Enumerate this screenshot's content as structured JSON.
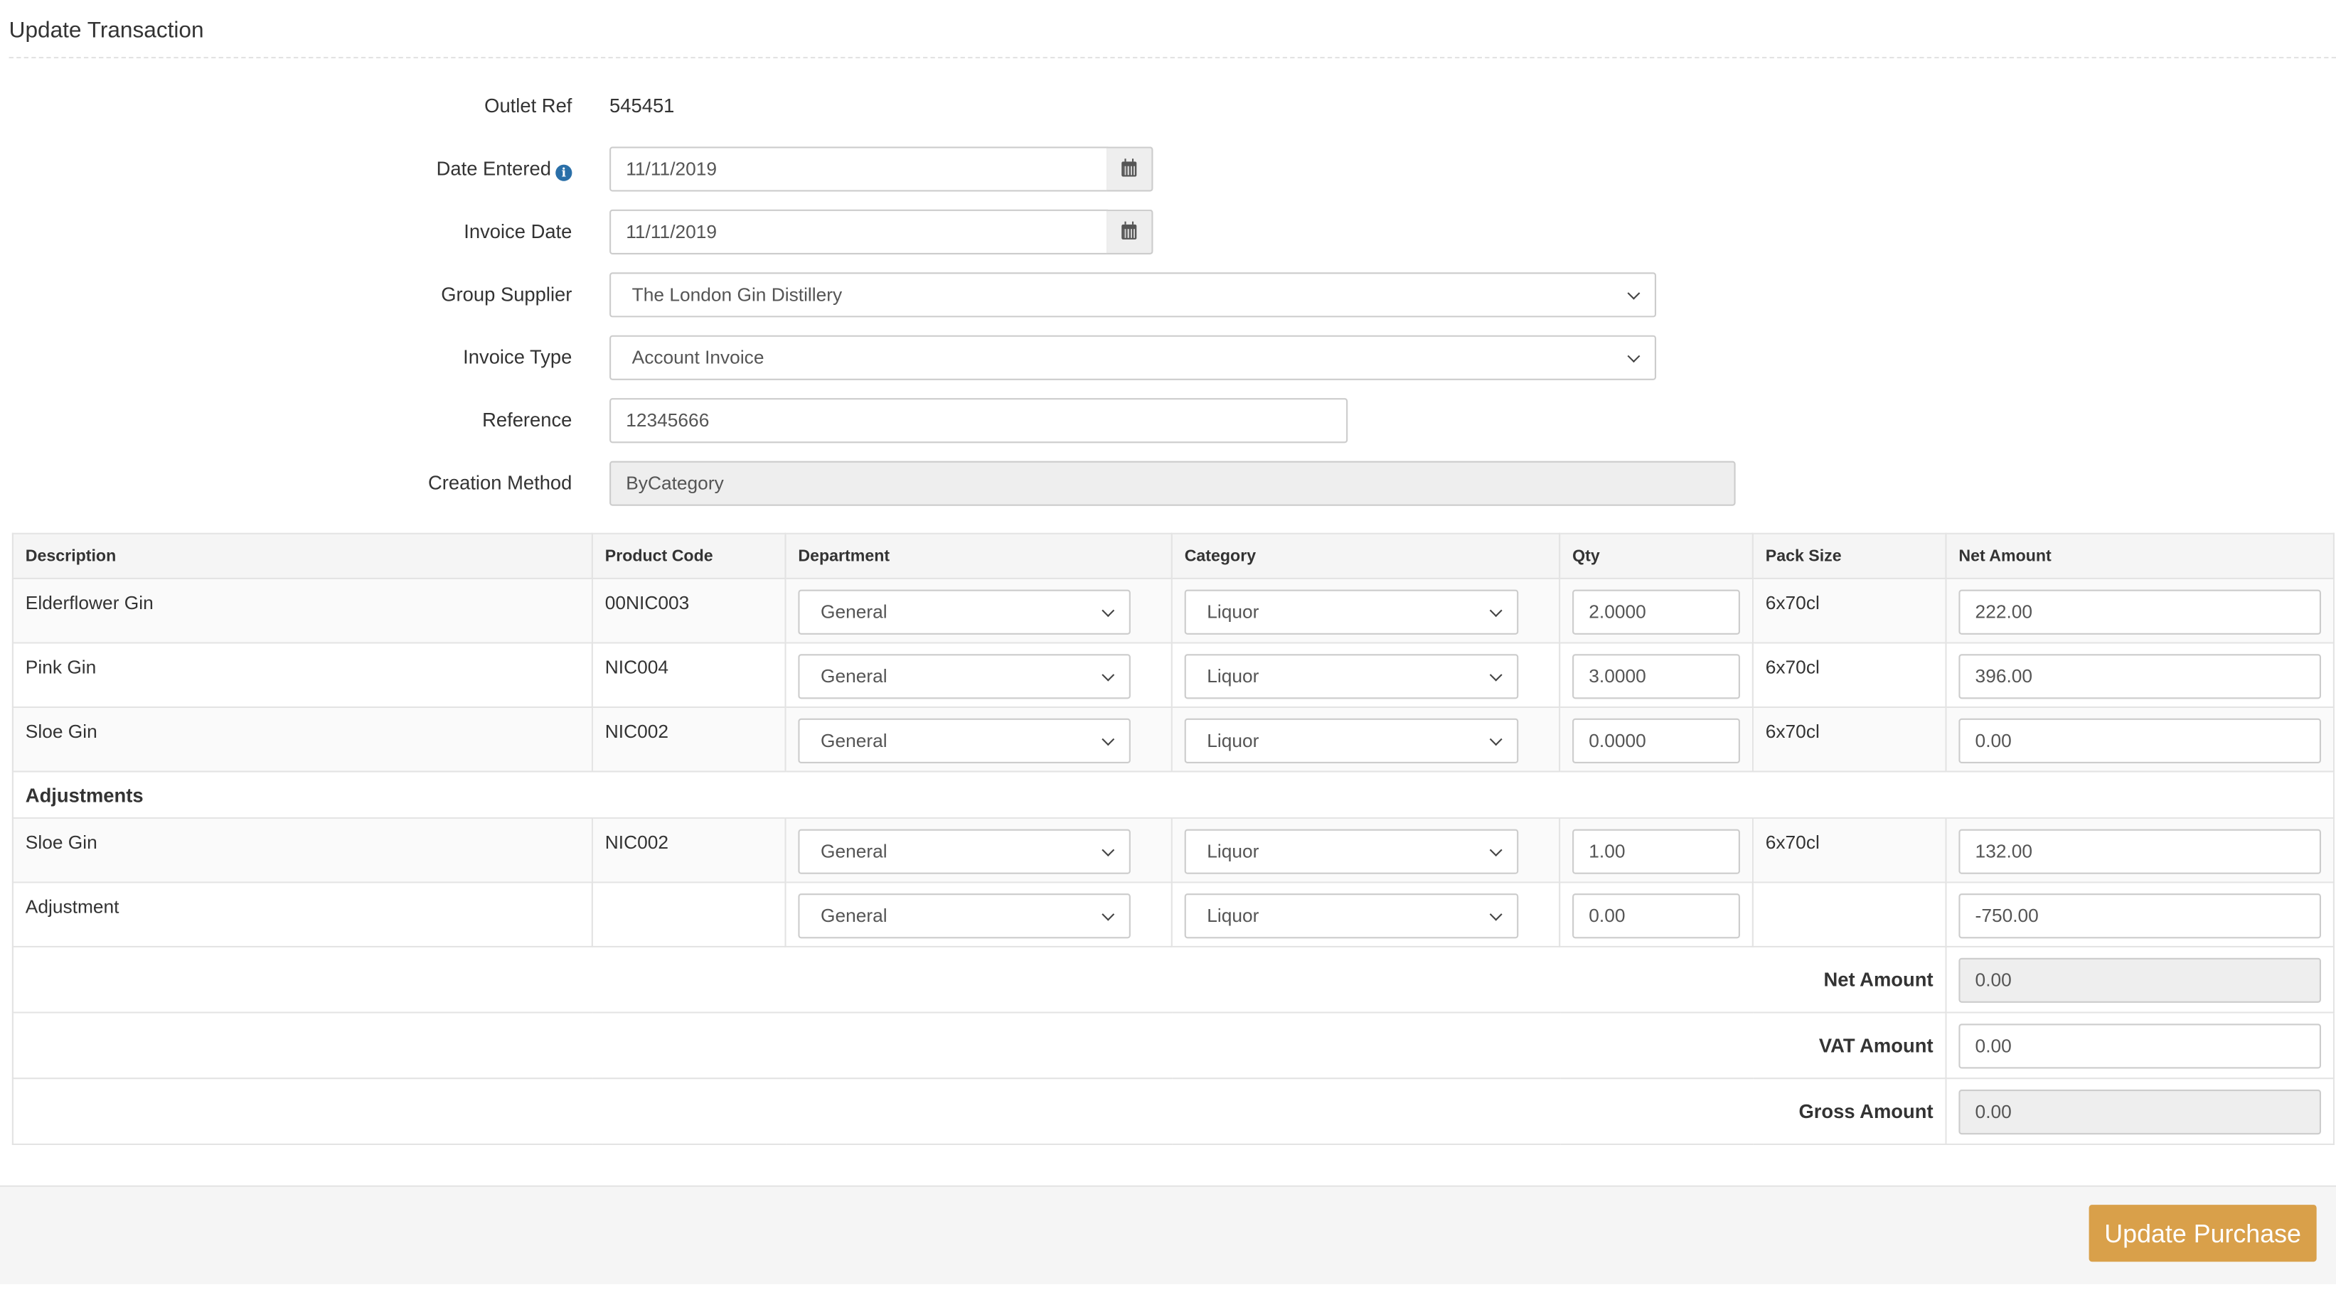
{
  "page": {
    "title": "Update Transaction"
  },
  "form": {
    "outlet_ref": {
      "label": "Outlet Ref",
      "value": "545451"
    },
    "date_entered": {
      "label": "Date Entered",
      "value": "11/11/2019"
    },
    "invoice_date": {
      "label": "Invoice Date",
      "value": "11/11/2019"
    },
    "group_supplier": {
      "label": "Group Supplier",
      "value": "The London Gin Distillery"
    },
    "invoice_type": {
      "label": "Invoice Type",
      "value": "Account Invoice"
    },
    "reference": {
      "label": "Reference",
      "value": "12345666"
    },
    "creation_method": {
      "label": "Creation Method",
      "value": "ByCategory"
    }
  },
  "table": {
    "headers": [
      "Description",
      "Product Code",
      "Department",
      "Category",
      "Qty",
      "Pack Size",
      "Net Amount"
    ],
    "rows": [
      {
        "description": "Elderflower Gin",
        "product_code": "00NIC003",
        "department": "General",
        "category": "Liquor",
        "qty": "2.0000",
        "pack_size": "6x70cl",
        "net_amount": "222.00"
      },
      {
        "description": "Pink Gin",
        "product_code": "NIC004",
        "department": "General",
        "category": "Liquor",
        "qty": "3.0000",
        "pack_size": "6x70cl",
        "net_amount": "396.00"
      },
      {
        "description": "Sloe Gin",
        "product_code": "NIC002",
        "department": "General",
        "category": "Liquor",
        "qty": "0.0000",
        "pack_size": "6x70cl",
        "net_amount": "0.00"
      }
    ],
    "adjustments_label": "Adjustments",
    "adjustments": [
      {
        "description": "Sloe Gin",
        "product_code": "NIC002",
        "department": "General",
        "category": "Liquor",
        "qty": "1.00",
        "pack_size": "6x70cl",
        "net_amount": "132.00"
      },
      {
        "description": "Adjustment",
        "product_code": "",
        "department": "General",
        "category": "Liquor",
        "qty": "0.00",
        "pack_size": "",
        "net_amount": "-750.00"
      }
    ],
    "totals": {
      "net": {
        "label": "Net Amount",
        "value": "0.00"
      },
      "vat": {
        "label": "VAT Amount",
        "value": "0.00"
      },
      "gross": {
        "label": "Gross Amount",
        "value": "0.00"
      }
    }
  },
  "footer": {
    "update_button": "Update Purchase"
  },
  "colors": {
    "accent": "#d9a04a",
    "info_icon": "#2a6fa8"
  }
}
